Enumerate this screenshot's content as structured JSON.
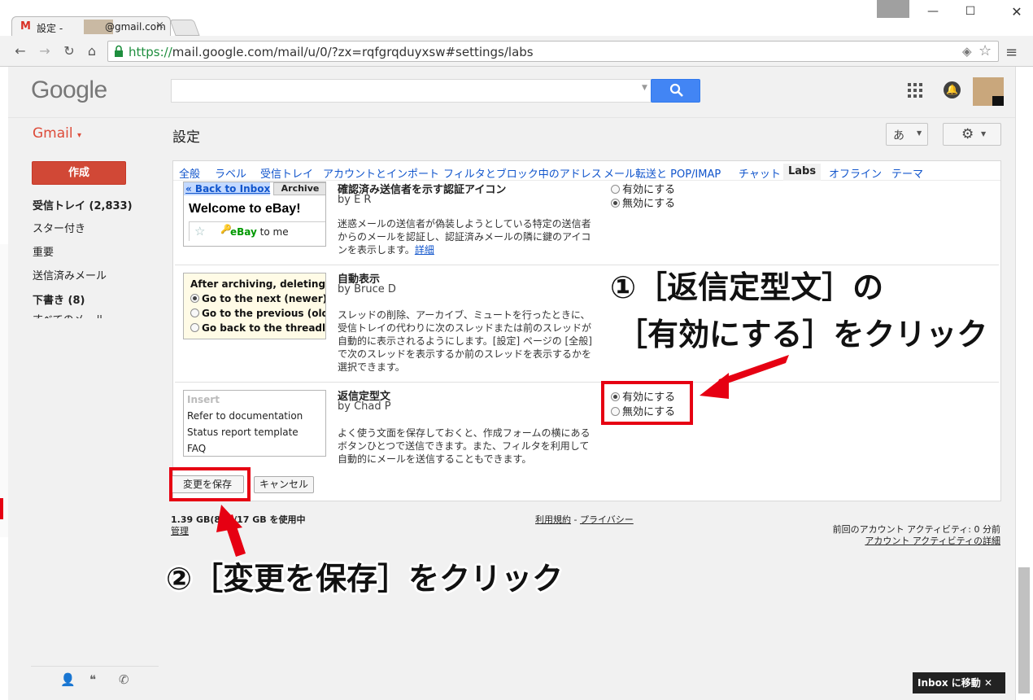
{
  "browser": {
    "tab_icon": "gmail-m-icon",
    "tab_title": "設定 - ",
    "tab_email_suffix": "@gmail.com",
    "tab_close": "×",
    "url_scheme": "https://",
    "url_rest": "mail.google.com/mail/u/0/?zx=rqfgrqduyxsw#settings/labs",
    "window_minimize": "—",
    "window_maximize": "☐",
    "window_close": "✕"
  },
  "header": {
    "logo": "Google",
    "search_placeholder": "",
    "app_label": "Gmail",
    "page_title": "設定",
    "ime_label": "あ"
  },
  "sidebar": {
    "compose_label": "作成",
    "items": [
      {
        "label": "受信トレイ (2,833)",
        "bold": true
      },
      {
        "label": "スター付き",
        "bold": false
      },
      {
        "label": "重要",
        "bold": false
      },
      {
        "label": "送信済みメール",
        "bold": false
      },
      {
        "label": "下書き (8)",
        "bold": true
      }
    ],
    "more_label": "すべてのメール"
  },
  "settings": {
    "tabs": [
      {
        "label": "全般"
      },
      {
        "label": "ラベル"
      },
      {
        "label": "受信トレイ"
      },
      {
        "label": "アカウントとインポート"
      },
      {
        "label": "フィルタとブロック中のアドレス"
      },
      {
        "label": "メール転送と POP/IMAP"
      },
      {
        "label": "チャット"
      },
      {
        "label": "Labs",
        "active": true
      },
      {
        "label": "オフライン"
      },
      {
        "label": "テーマ"
      }
    ],
    "labs": [
      {
        "title": "確認済み送信者を示す認証アイコン",
        "author": "by E R",
        "description": "迷惑メールの送信者が偽装しようとしている特定の送信者からのメールを認証し、認証済みメールの隣に鍵のアイコンを表示します。",
        "details_link": "詳細",
        "preview": {
          "back_link": "« Back to Inbox",
          "archive_button": "Archive",
          "welcome": "Welcome to eBay!",
          "sender": "eBay",
          "to": "to me"
        },
        "enable_label": "有効にする",
        "disable_label": "無効にする",
        "selected": "disable"
      },
      {
        "title": "自動表示",
        "author": "by Bruce D",
        "description": "スレッドの削除、アーカイブ、ミュートを行ったときに、受信トレイの代わりに次のスレッドまたは前のスレッドが自動的に表示されるようにします。[設定] ページの [全般] で次のスレッドを表示するか前のスレッドを表示するかを選択できます。",
        "preview": {
          "heading": "After archiving, deleting, m",
          "options": [
            "Go to the next (newer)",
            "Go to the previous (olde",
            "Go back to the threadlis"
          ]
        }
      },
      {
        "title": "返信定型文",
        "author": "by Chad P",
        "description": "よく使う文面を保存しておくと、作成フォームの横にあるボタンひとつで送信できます。また、フィルタを利用して自動的にメールを送信することもできます。",
        "preview": {
          "lines": [
            "Insert",
            "Refer to documentation",
            "Status report template",
            "FAQ"
          ]
        },
        "enable_label": "有効にする",
        "disable_label": "無効にする",
        "selected": "enable"
      }
    ],
    "save_label": "変更を保存",
    "cancel_label": "キャンセル"
  },
  "footer": {
    "storage": "1.39 GB(8%)/17 GB を使用中",
    "manage": "管理",
    "terms": "利用規約",
    "separator": " - ",
    "privacy": "プライバシー",
    "last_activity": "前回のアカウント アクティビティ: 0 分前",
    "activity_details": "アカウント アクティビティの詳細"
  },
  "inbox_button": "Inbox に移動 ✕",
  "annotations": {
    "callout1_line1": "①［返信定型文］の",
    "callout1_line2": "［有効にする］をクリック",
    "callout2": "②［変更を保存］をクリック",
    "highlight_color": "#e60012"
  },
  "colors": {
    "accent_blue": "#4285f4",
    "compose_red": "#d14836",
    "gmail_red": "#dd4b39",
    "link_blue": "#1155cc"
  }
}
